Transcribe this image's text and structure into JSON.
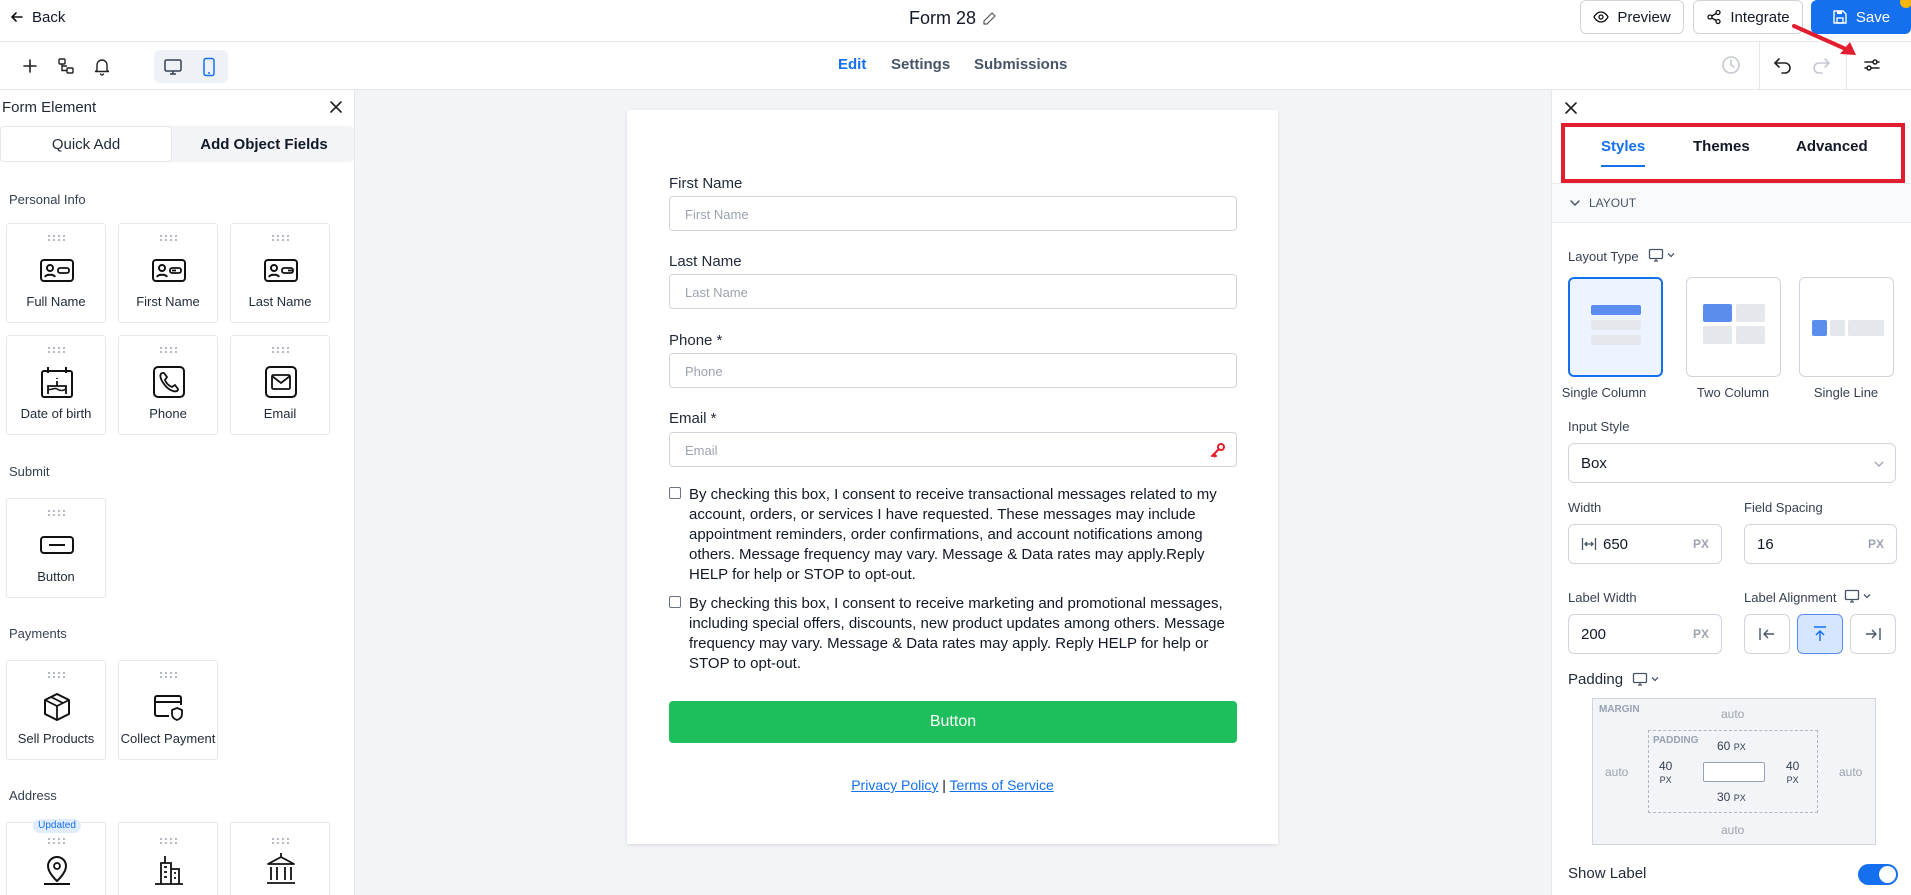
{
  "header": {
    "back_label": "Back",
    "title": "Form 28",
    "preview_label": "Preview",
    "integrate_label": "Integrate",
    "save_label": "Save"
  },
  "nav": {
    "tabs": [
      "Edit",
      "Settings",
      "Submissions"
    ],
    "active_tab": "Edit"
  },
  "left_panel": {
    "title": "Form Element",
    "tabs": [
      "Quick Add",
      "Add Object Fields"
    ],
    "sections": [
      {
        "title": "Personal Info",
        "items": [
          "Full Name",
          "First Name",
          "Last Name",
          "Date of birth",
          "Phone",
          "Email"
        ]
      },
      {
        "title": "Submit",
        "items": [
          "Button"
        ]
      },
      {
        "title": "Payments",
        "items": [
          "Sell Products",
          "Collect Payment"
        ]
      },
      {
        "title": "Address",
        "items": [
          "",
          "",
          ""
        ],
        "badge": "Updated"
      }
    ]
  },
  "form": {
    "fields": [
      {
        "label": "First Name",
        "placeholder": "First Name"
      },
      {
        "label": "Last Name",
        "placeholder": "Last Name"
      },
      {
        "label": "Phone *",
        "placeholder": "Phone"
      },
      {
        "label": "Email *",
        "placeholder": "Email"
      }
    ],
    "consents": [
      "By checking this box, I consent to receive transactional messages related to my account, orders, or services I have requested. These messages may include appointment reminders, order confirmations, and account notifications among others. Message frequency may vary. Message & Data rates may apply.Reply HELP for help or STOP to opt-out.",
      "By checking this box, I consent to receive marketing and promotional messages, including special offers, discounts, new product updates among others. Message frequency may vary. Message & Data rates may apply. Reply HELP for help or STOP to opt-out."
    ],
    "button_label": "Button",
    "privacy_label": "Privacy Policy",
    "separator": "|",
    "terms_label": "Terms of Service"
  },
  "right_panel": {
    "tabs": [
      "Styles",
      "Themes",
      "Advanced"
    ],
    "active_tab": "Styles",
    "section_title": "LAYOUT",
    "layout_type_label": "Layout Type",
    "layout_options": [
      "Single Column",
      "Two Column",
      "Single Line"
    ],
    "selected_layout": "Single Column",
    "input_style_label": "Input Style",
    "input_style_value": "Box",
    "width_label": "Width",
    "width_value": "650",
    "field_spacing_label": "Field Spacing",
    "field_spacing_value": "16",
    "unit": "PX",
    "label_width_label": "Label Width",
    "label_width_value": "200",
    "label_alignment_label": "Label Alignment",
    "padding_label": "Padding",
    "box_model": {
      "margin_label": "MARGIN",
      "padding_label": "PADDING",
      "margin_top": "auto",
      "margin_bottom": "auto",
      "margin_left": "auto",
      "margin_right": "auto",
      "padding_top": "60",
      "padding_bottom": "30",
      "padding_left": "40",
      "padding_right": "40",
      "unit": "PX"
    },
    "show_label": "Show Label",
    "show_label_enabled": true
  },
  "colors": {
    "accent": "#1570ef",
    "submit_button": "#1cbf5b",
    "highlight_box": "#e11d2e",
    "canvas_bg": "#f2f4f7"
  }
}
